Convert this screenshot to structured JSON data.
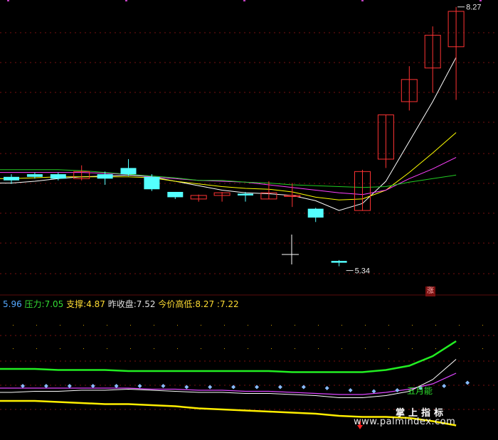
{
  "info": {
    "first_value": "5.96",
    "pressure_label": "压力:",
    "pressure_value": "7.05",
    "support_label": "支撑:",
    "support_value": "4.87",
    "prev_close_label": "昨收盘:",
    "prev_close_value": "7.52",
    "today_hl_label": "今价高低:",
    "today_high": "8.27",
    "separator": ":",
    "today_low": "7.22"
  },
  "annotations": {
    "high_label": "8.27",
    "low_label": "5.34",
    "zhang_badge": "涨",
    "indicator_label": "五月能",
    "watermark_cn": "掌上指标",
    "watermark_url": "www.palmindex.com"
  },
  "colors": {
    "up": "#ff3333",
    "down": "#54ffff",
    "ma_white": "#ffffff",
    "ma_yellow": "#ffff00",
    "ma_magenta": "#ff40ff",
    "ma_green": "#22cc22",
    "grid": "#7a1010",
    "info_first": "#54a8ff",
    "info_pressure": "#33dd33",
    "info_support": "#ffdd33",
    "info_text": "#e0e0e0"
  },
  "chart_data": {
    "type": "candlestick",
    "ylim": [
      5.2,
      8.3
    ],
    "candles": [
      {
        "open": 6.35,
        "close": 6.31,
        "high": 6.38,
        "low": 6.27
      },
      {
        "open": 6.38,
        "close": 6.35,
        "high": 6.4,
        "low": 6.33
      },
      {
        "open": 6.38,
        "close": 6.33,
        "high": 6.4,
        "low": 6.31
      },
      {
        "open": 6.33,
        "close": 6.41,
        "high": 6.48,
        "low": 6.31
      },
      {
        "open": 6.38,
        "close": 6.33,
        "high": 6.41,
        "low": 6.26
      },
      {
        "open": 6.45,
        "close": 6.38,
        "high": 6.55,
        "low": 6.36
      },
      {
        "open": 6.35,
        "close": 6.21,
        "high": 6.38,
        "low": 6.19
      },
      {
        "open": 6.18,
        "close": 6.12,
        "high": 6.18,
        "low": 6.1
      },
      {
        "open": 6.1,
        "close": 6.14,
        "high": 6.15,
        "low": 6.07
      },
      {
        "open": 6.14,
        "close": 6.17,
        "high": 6.18,
        "low": 6.07
      },
      {
        "open": 6.16,
        "close": 6.14,
        "high": 6.18,
        "low": 6.07
      },
      {
        "open": 6.1,
        "close": 6.17,
        "high": 6.3,
        "low": 6.1
      },
      {
        "open": 6.14,
        "close": 6.14,
        "high": 6.28,
        "low": 6.01
      },
      {
        "open": 5.99,
        "close": 5.89,
        "high": 6.0,
        "low": 5.84
      },
      {
        "open": 5.4,
        "close": 5.38,
        "high": 5.41,
        "low": 5.34
      },
      {
        "open": 5.97,
        "close": 6.41,
        "high": 6.43,
        "low": 5.97
      },
      {
        "open": 6.55,
        "close": 7.05,
        "high": 7.05,
        "low": 6.45
      },
      {
        "open": 7.2,
        "close": 7.45,
        "high": 7.6,
        "low": 7.1
      },
      {
        "open": 7.58,
        "close": 7.95,
        "high": 8.05,
        "low": 7.3
      },
      {
        "open": 7.82,
        "close": 8.22,
        "high": 8.27,
        "low": 7.22
      }
    ],
    "ma": [
      {
        "color": "white",
        "values": [
          6.28,
          6.3,
          6.33,
          6.35,
          6.36,
          6.37,
          6.35,
          6.3,
          6.25,
          6.2,
          6.17,
          6.16,
          6.14,
          6.08,
          5.97,
          6.05,
          6.3,
          6.75,
          7.2,
          7.7
        ]
      },
      {
        "color": "yellow",
        "values": [
          6.33,
          6.34,
          6.35,
          6.35,
          6.35,
          6.35,
          6.34,
          6.3,
          6.27,
          6.24,
          6.22,
          6.21,
          6.18,
          6.12,
          6.09,
          6.1,
          6.2,
          6.4,
          6.62,
          6.85
        ]
      },
      {
        "color": "magenta",
        "values": [
          6.4,
          6.4,
          6.4,
          6.4,
          6.39,
          6.38,
          6.35,
          6.33,
          6.31,
          6.3,
          6.29,
          6.26,
          6.23,
          6.2,
          6.17,
          6.15,
          6.2,
          6.33,
          6.44,
          6.57
        ]
      },
      {
        "color": "green",
        "values": [
          6.43,
          6.43,
          6.43,
          6.42,
          6.4,
          6.38,
          6.36,
          6.34,
          6.31,
          6.31,
          6.29,
          6.28,
          6.26,
          6.25,
          6.24,
          6.23,
          6.24,
          6.29,
          6.33,
          6.37
        ]
      }
    ],
    "indicator": {
      "ylim": [
        0,
        100
      ],
      "upper_green": [
        54,
        54,
        53,
        53,
        53,
        52,
        52,
        52,
        52,
        52,
        52,
        52,
        51,
        51,
        51,
        51,
        53,
        57,
        66,
        80
      ],
      "lower_yellow": [
        24,
        24,
        23,
        22,
        21,
        21,
        20,
        19,
        17,
        16,
        15,
        14,
        13,
        12,
        10,
        9,
        9,
        8,
        5,
        1
      ],
      "white": [
        32,
        33,
        33,
        34,
        34,
        35,
        34,
        33,
        32,
        32,
        31,
        31,
        30,
        29,
        27,
        27,
        29,
        33,
        44,
        63
      ],
      "magenta": [
        36,
        36,
        36,
        36,
        36,
        36,
        35,
        35,
        34,
        34,
        33,
        33,
        32,
        31,
        30,
        30,
        32,
        35,
        40,
        50
      ],
      "dots": [
        38,
        38,
        38,
        38,
        38,
        38,
        38,
        37,
        37,
        37,
        37,
        37,
        37,
        36,
        34,
        33,
        34,
        36,
        38,
        41
      ]
    }
  }
}
